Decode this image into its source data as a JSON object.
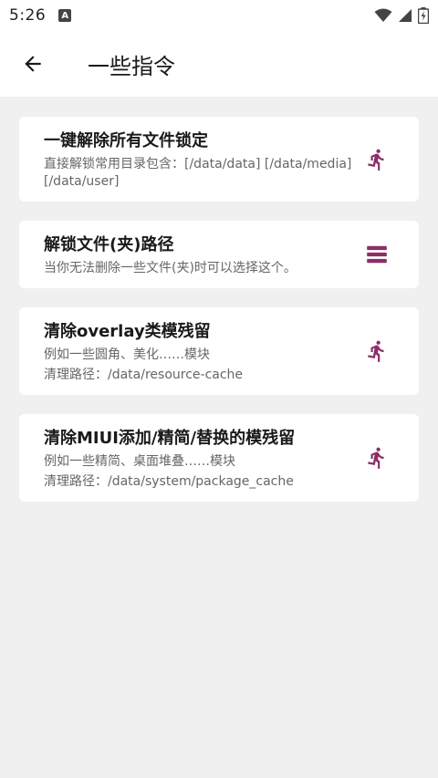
{
  "status_bar": {
    "time": "5:26",
    "notification_icon": "A"
  },
  "app_bar": {
    "title": "一些指令",
    "back_icon": "arrow-back-icon"
  },
  "colors": {
    "accent": "#8c2f66",
    "background": "#f0f0f0",
    "card": "#ffffff"
  },
  "cards": [
    {
      "title": "一键解除所有文件锁定",
      "desc": [
        "直接解锁常用目录包含：[/data/data] [/data/media] [/data/user]"
      ],
      "icon": "run-icon"
    },
    {
      "title": "解锁文件(夹)路径",
      "desc": [
        "当你无法删除一些文件(夹)时可以选择这个。"
      ],
      "icon": "menu-icon"
    },
    {
      "title": "清除overlay类模残留",
      "desc": [
        "例如一些圆角、美化……模块",
        "清理路径：/data/resource-cache"
      ],
      "icon": "run-icon"
    },
    {
      "title": "清除MIUI添加/精简/替换的模残留",
      "desc": [
        "例如一些精简、桌面堆叠……模块",
        "清理路径：/data/system/package_cache"
      ],
      "icon": "run-icon"
    }
  ]
}
